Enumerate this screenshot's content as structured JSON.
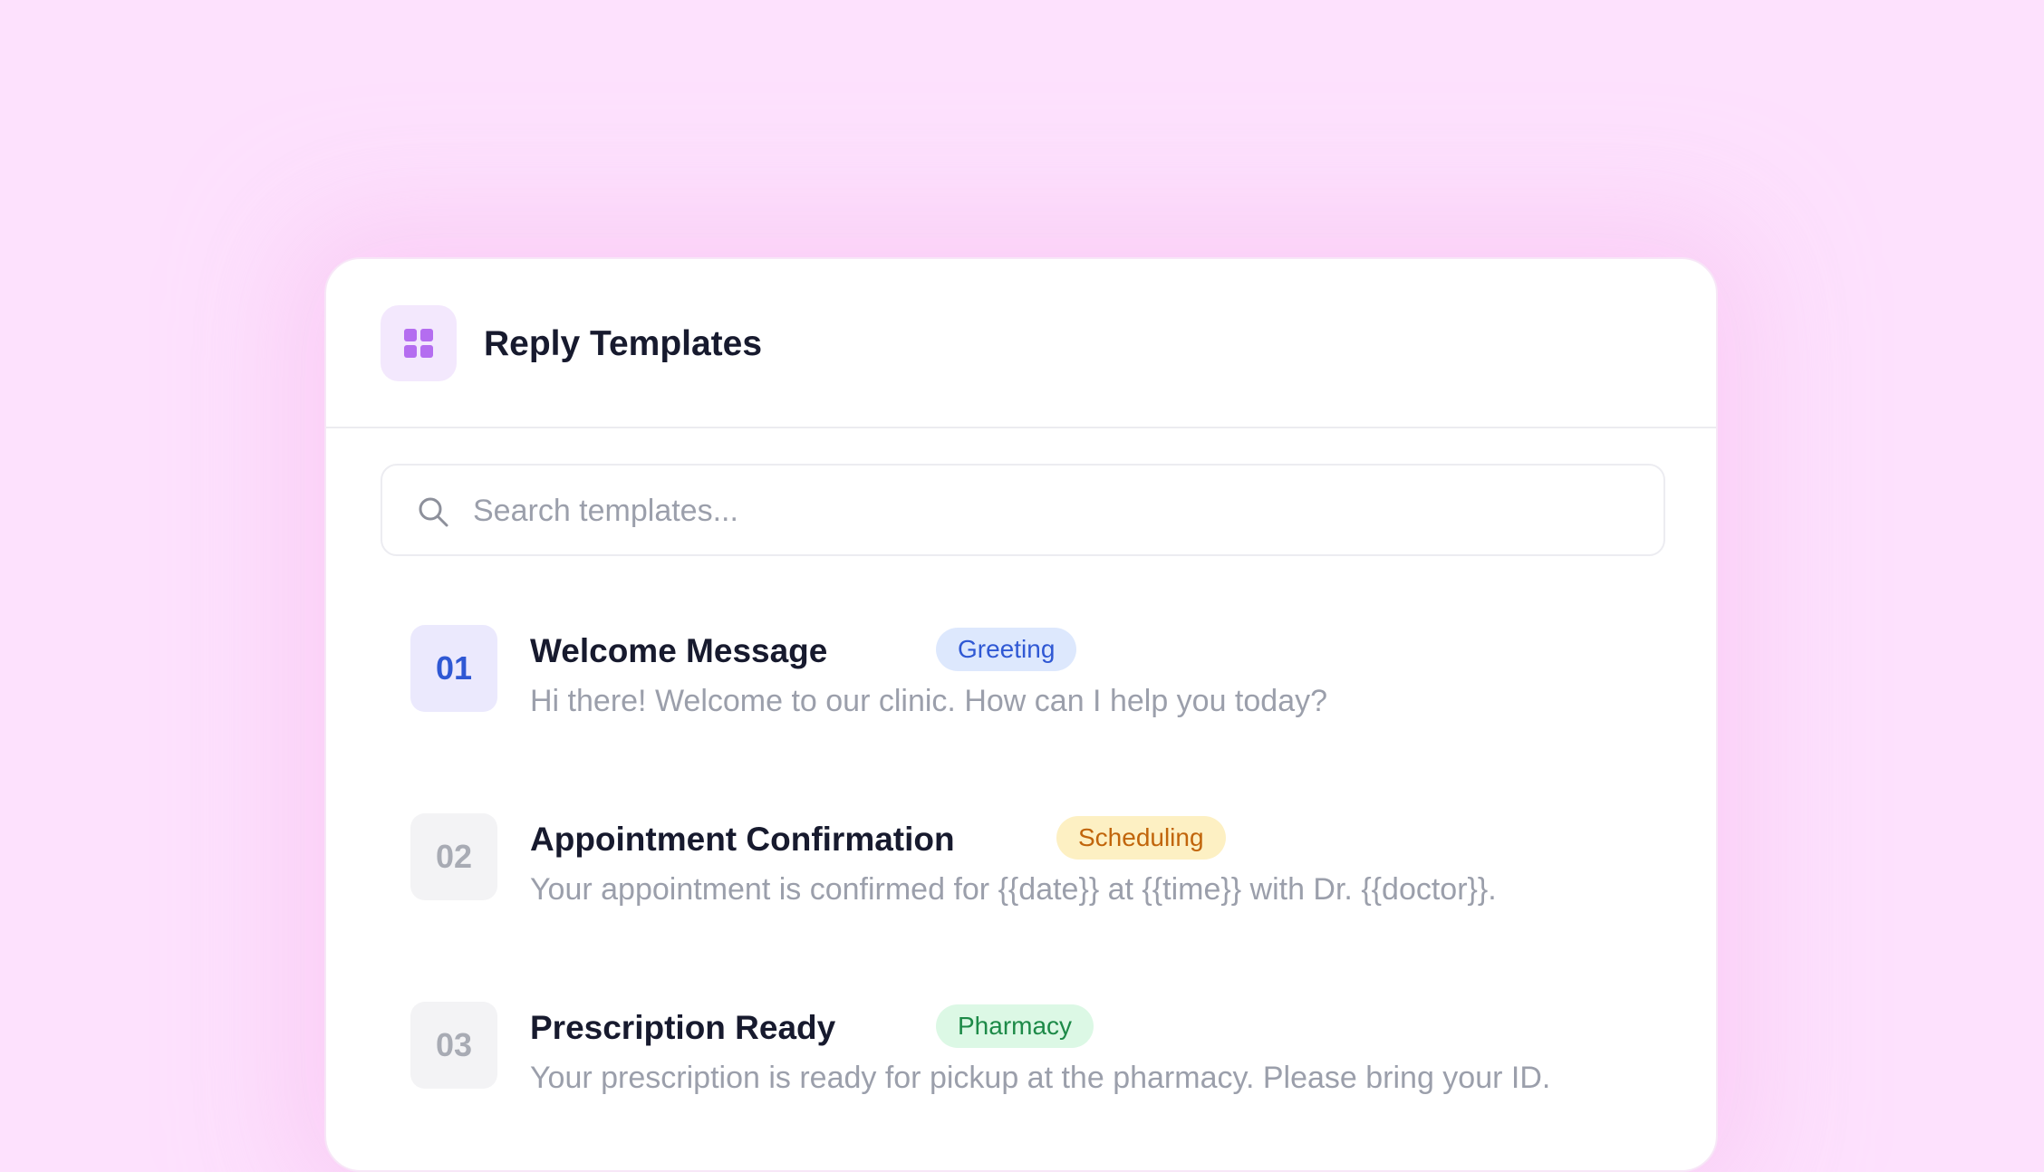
{
  "panel": {
    "title": "Reply Templates",
    "app_icon": "grid-icon",
    "accent_color": "#b46df0"
  },
  "search": {
    "icon": "search-icon",
    "placeholder": "Search templates..."
  },
  "templates": [
    {
      "number": "01",
      "title": "Welcome Message",
      "tag": "Greeting",
      "tag_color": "#2f58d4",
      "description": "Hi there! Welcome to our clinic. How can I help you today?",
      "selected": true
    },
    {
      "number": "02",
      "title": "Appointment Confirmation",
      "tag": "Scheduling",
      "tag_color": "#c1650b",
      "description": "Your appointment is confirmed for {{date}} at {{time}} with Dr. {{doctor}}.",
      "selected": false
    },
    {
      "number": "03",
      "title": "Prescription Ready",
      "tag": "Pharmacy",
      "tag_color": "#1d8a48",
      "description": "Your prescription is ready for pickup at the pharmacy. Please bring your ID.",
      "selected": false
    }
  ]
}
